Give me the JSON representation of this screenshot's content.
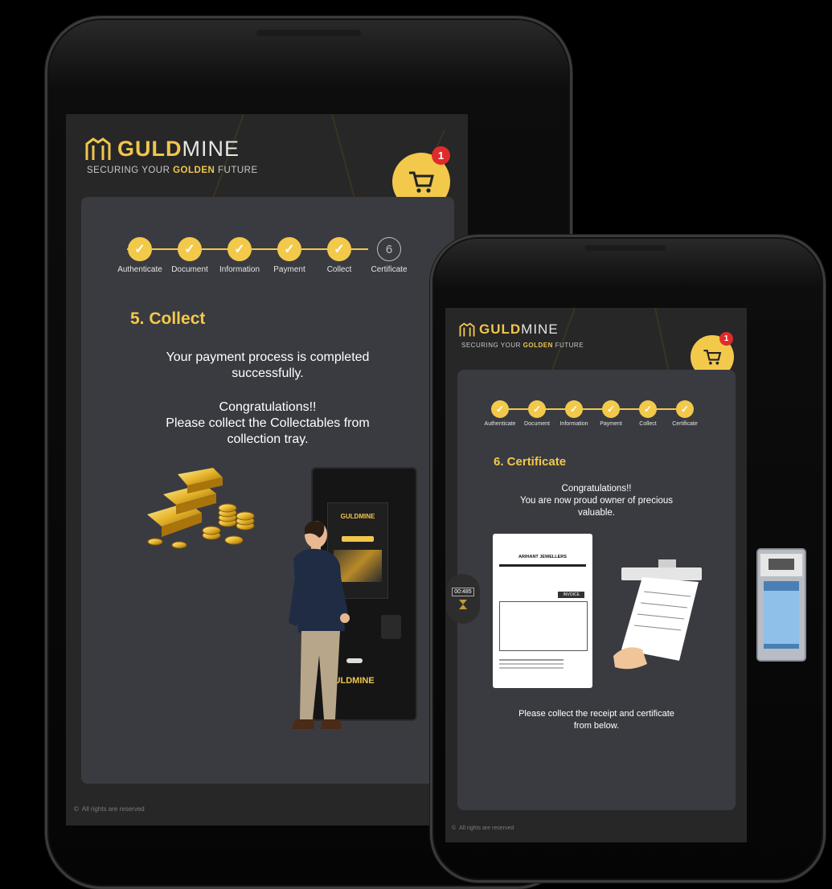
{
  "brand": {
    "logo_prefix": "G",
    "logo_gold": "ULD",
    "logo_rest": "MINE",
    "logo_full_gold": "GULD",
    "tagline_before": "SECURING YOUR ",
    "tagline_gold": "GOLDEN",
    "tagline_after": " FUTURE"
  },
  "colors": {
    "accent": "#f3c94b",
    "badge": "#e02b2b",
    "card": "#3a3b40",
    "screen_bg": "#272727"
  },
  "cart": {
    "icon": "cart-icon",
    "count": "1"
  },
  "steps": [
    {
      "label": "Authenticate"
    },
    {
      "label": "Document"
    },
    {
      "label": "Information"
    },
    {
      "label": "Payment"
    },
    {
      "label": "Collect"
    },
    {
      "label": "Certificate"
    }
  ],
  "screen1": {
    "pending_step_number": "6",
    "heading": "5. Collect",
    "msg_line1": "Your payment process is completed",
    "msg_line2": "successfully.",
    "msg_line3": "Congratulations!!",
    "msg_line4": "Please collect the Collectables from",
    "msg_line5": "collection tray.",
    "kiosk_brand": "GULDMINE",
    "footer": "All rights are reserved"
  },
  "screen2": {
    "heading": "6. Certificate",
    "msg_line1": "Congratulations!!",
    "msg_line2": "You are now proud owner of precious",
    "msg_line3": "valuable.",
    "receipt_title": "ARIHANT JEWELLERS",
    "receipt_tag": "INVOICE",
    "collect_line1": "Please collect the receipt and certificate",
    "collect_line2": "from below.",
    "footer": "All rights are reserved"
  },
  "timer": {
    "value": "00:485"
  }
}
